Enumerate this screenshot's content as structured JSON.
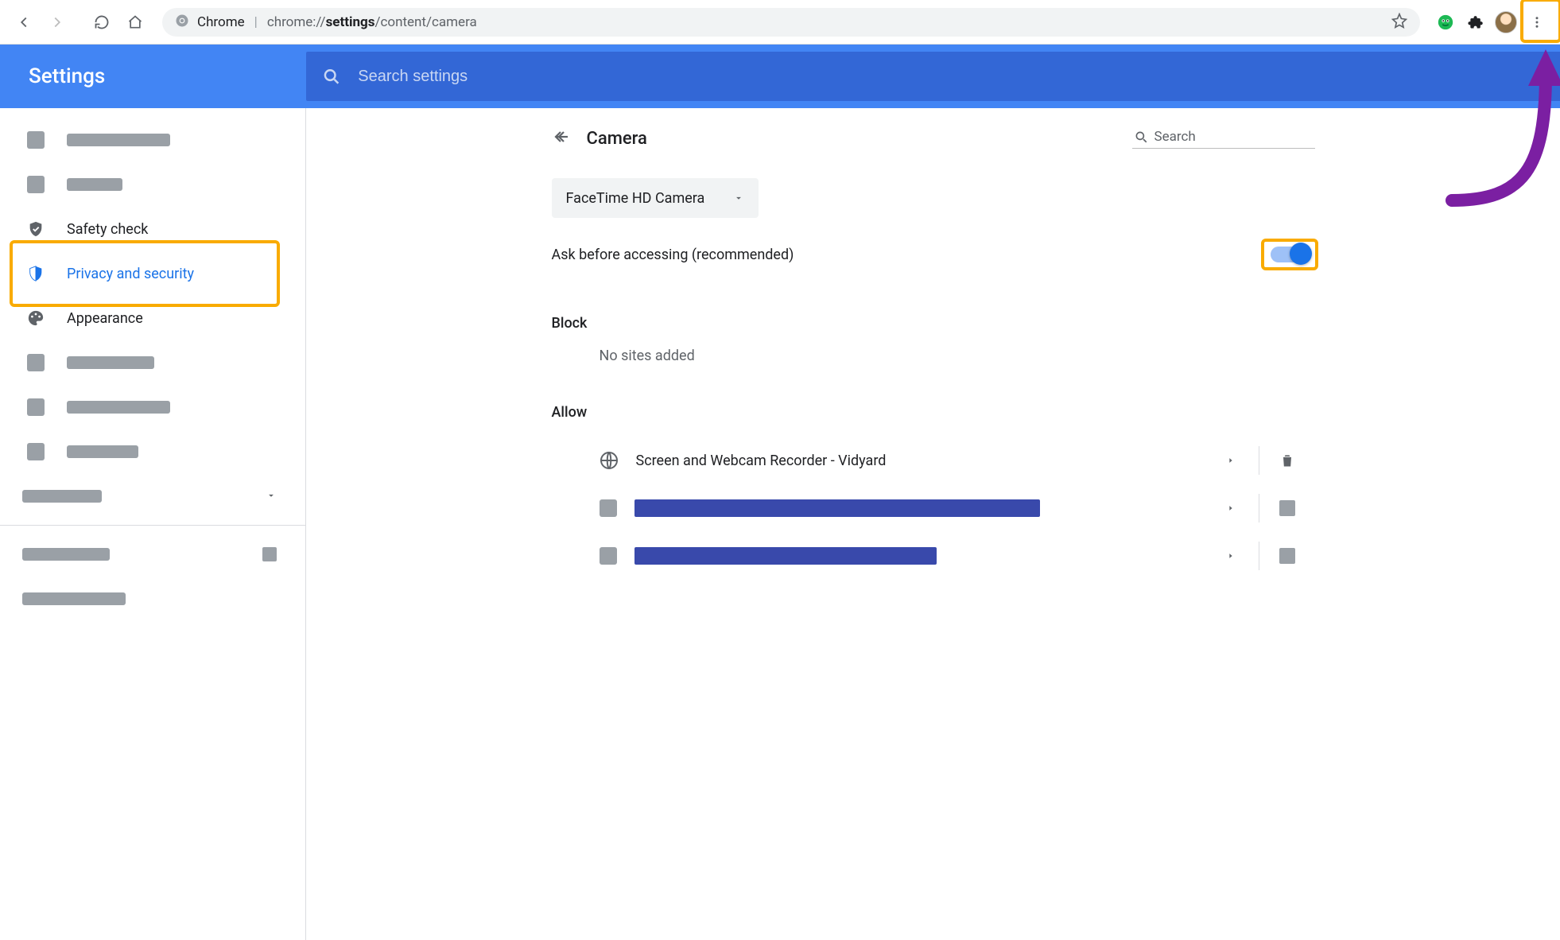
{
  "browser": {
    "app_label": "Chrome",
    "url_prefix": "chrome://",
    "url_bold": "settings",
    "url_suffix": "/content/camera"
  },
  "header": {
    "title": "Settings",
    "search_placeholder": "Search settings"
  },
  "sidebar": {
    "safety_check": "Safety check",
    "privacy": "Privacy and security",
    "appearance": "Appearance"
  },
  "page": {
    "title": "Camera",
    "local_search_placeholder": "Search",
    "camera_dropdown": "FaceTime HD Camera",
    "ask_label": "Ask before accessing (recommended)",
    "block_heading": "Block",
    "no_sites": "No sites added",
    "allow_heading": "Allow",
    "allow_site_1": "Screen and Webcam Recorder - Vidyard"
  }
}
